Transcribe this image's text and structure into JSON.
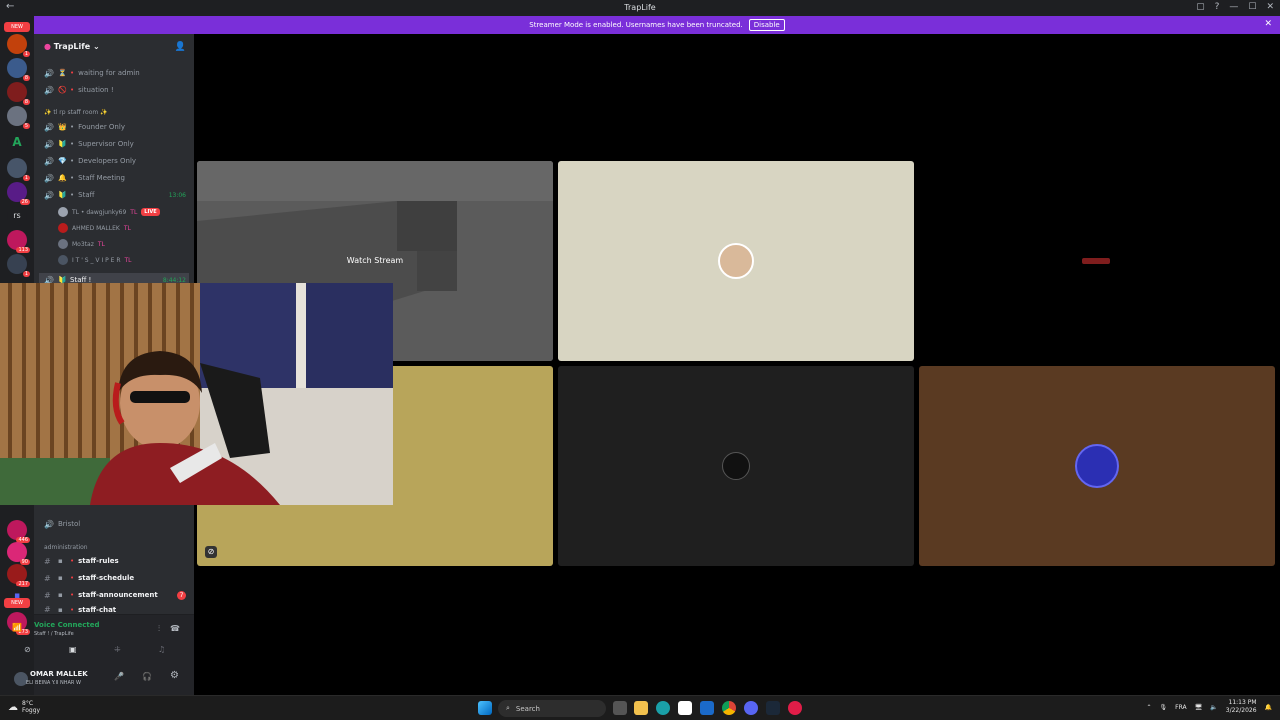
{
  "window": {
    "title": "TrapLife"
  },
  "banner": {
    "text": "Streamer Mode is enabled. Usernames have been truncated.",
    "disable_label": "Disable"
  },
  "rail": {
    "new_label": "NEW",
    "badges": [
      "1",
      "8",
      "8",
      "5",
      "1",
      "26",
      "113",
      "1",
      "446",
      "90",
      "217",
      "273"
    ]
  },
  "server": {
    "name": "TrapLife"
  },
  "channels": {
    "top": [
      {
        "emoji": "⏳",
        "name": "waiting for admin"
      },
      {
        "emoji": "🚫",
        "name": "situation !"
      }
    ],
    "category_staff_room": "✨ tl rp staff room ✨",
    "staff_rooms": [
      {
        "emoji": "👑",
        "name": "Founder Only"
      },
      {
        "emoji": "🔰",
        "name": "Supervisor Only"
      },
      {
        "emoji": "💎",
        "name": "Developers Only"
      },
      {
        "emoji": "🔔",
        "name": "Staff Meeting"
      },
      {
        "emoji": "🔰",
        "name": "Staff",
        "time": "13:06"
      }
    ],
    "voice_users": [
      {
        "name": "TL • dawgjunky69",
        "tag": "TL",
        "live": "LIVE"
      },
      {
        "name": "AHMED MALLEK",
        "tag": "TL"
      },
      {
        "name": "Mo3taz",
        "tag": "TL"
      },
      {
        "name": "I T ' S _ V I P E R",
        "tag": "TL"
      }
    ],
    "staff_active": {
      "name": "Staff !",
      "time": "8:44:12"
    },
    "bristol": "Bristol",
    "category_admin": "administration",
    "text_channels": [
      {
        "name": "staff-rules"
      },
      {
        "name": "staff-schedule"
      },
      {
        "name": "staff-announcement",
        "mentions": "7"
      },
      {
        "name": "staff-chat"
      }
    ]
  },
  "voice": {
    "status": "Voice Connected",
    "location": "Staff ! / TrapLife"
  },
  "user": {
    "name": "OMAR MALLEK",
    "status": "ELI BEINA Y.II NHAR W"
  },
  "stage": {
    "watch_label": "Watch Stream"
  },
  "taskbar": {
    "weather_temp": "8°C",
    "weather_desc": "Foggy",
    "search_placeholder": "Search",
    "lang": "FRA",
    "time": "11:13 PM",
    "date": "3/22/2026"
  },
  "colors": {
    "accent": "#7a2fd9",
    "tile_beige": "#d8d5c2",
    "tile_gold": "#b8a55a",
    "tile_brown": "#5a3a22",
    "tile_dark": "#1f1f1f",
    "online": "#23a55a"
  }
}
